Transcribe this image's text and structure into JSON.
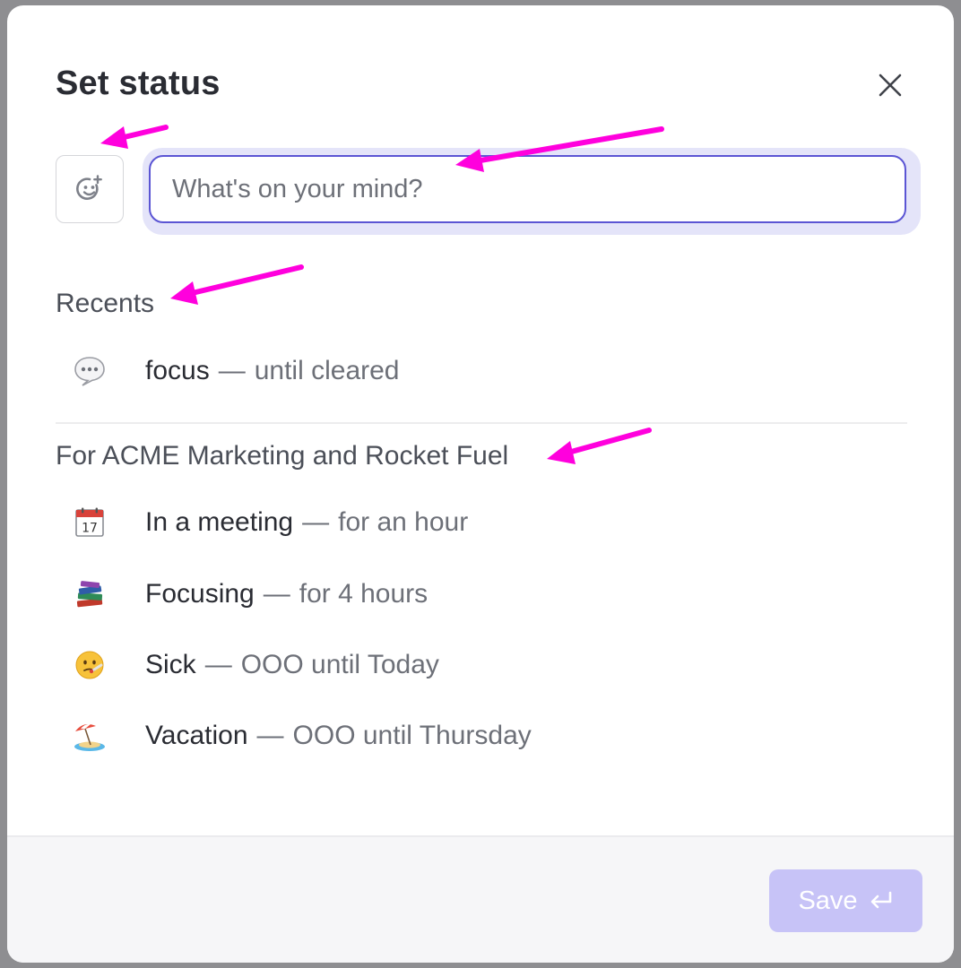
{
  "dialog": {
    "title": "Set status"
  },
  "input": {
    "placeholder": "What's on your mind?",
    "value": ""
  },
  "icons": {
    "close": "close-icon",
    "emoji_picker": "emoji-add-icon",
    "save_return": "return-icon"
  },
  "recents": {
    "heading": "Recents",
    "items": [
      {
        "emoji": "speech-balloon",
        "text": "focus",
        "separator": "—",
        "detail": "until cleared"
      }
    ]
  },
  "workspace": {
    "heading": "For ACME Marketing and Rocket Fuel",
    "items": [
      {
        "emoji": "calendar",
        "text": "In a meeting",
        "separator": "—",
        "detail": "for an hour"
      },
      {
        "emoji": "books",
        "text": "Focusing",
        "separator": "—",
        "detail": "for 4 hours"
      },
      {
        "emoji": "face-with-thermometer",
        "text": "Sick",
        "separator": "—",
        "detail": "OOO until Today"
      },
      {
        "emoji": "beach-with-umbrella",
        "text": "Vacation",
        "separator": "—",
        "detail": "OOO until Thursday"
      }
    ]
  },
  "footer": {
    "save_label": "Save"
  },
  "colors": {
    "accent": "#5b55d4",
    "save_disabled": "#c7c3f7",
    "annotation": "#ff00dd"
  }
}
